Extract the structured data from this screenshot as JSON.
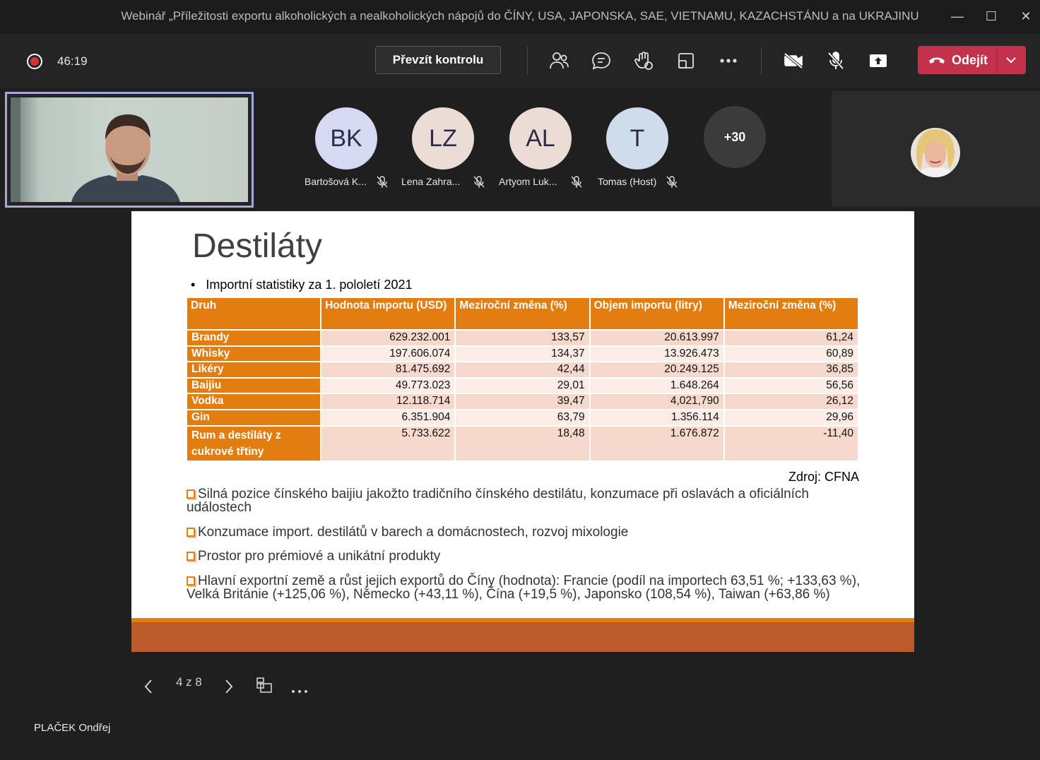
{
  "window": {
    "title": "Webinář „Příležitosti exportu alkoholických a nealkoholických nápojů do ČÍNY, USA, JAPONSKA, SAE, VIETNAMU, KAZACHSTÁNU a na UKRAJINU"
  },
  "toolbar": {
    "timer": "46:19",
    "take_control_label": "Převzít kontrolu",
    "leave_label": "Odejít",
    "icons": [
      "participants-icon",
      "chat-icon",
      "raise-hand-icon",
      "room-icon",
      "more-icon",
      "camera-off-icon",
      "mic-off-icon",
      "share-icon"
    ]
  },
  "participants": [
    {
      "initials": "BK",
      "name": "Bartošová K...",
      "color": "#d6d9f2"
    },
    {
      "initials": "LZ",
      "name": "Lena Zahra...",
      "color": "#ecdcd6"
    },
    {
      "initials": "AL",
      "name": "Artyom Luk...",
      "color": "#ecdcd6"
    },
    {
      "initials": "T",
      "name": "Tomas (Host)",
      "color": "#cfdcec"
    },
    {
      "initials": "+30",
      "name": "",
      "color": "#3b3b3b"
    }
  ],
  "slide": {
    "title": "Destiláty",
    "subtitle": "Importní statistiky za 1. pololetí 2021",
    "table": {
      "headers": [
        "Druh",
        "Hodnota importu (USD)",
        "Meziroční změna (%)",
        "Objem importu (litry)",
        "Meziroční změna (%)"
      ],
      "rows": [
        [
          "Brandy",
          "629.232.001",
          "133,57",
          "20.613.997",
          "61,24"
        ],
        [
          "Whisky",
          "197.606.074",
          "134,37",
          "13.926.473",
          "60,89"
        ],
        [
          "Likéry",
          "81.475.692",
          "42,44",
          "20.249.125",
          "36,85"
        ],
        [
          "Baijiu",
          "49.773.023",
          "29,01",
          "1.648.264",
          "56,56"
        ],
        [
          "Vodka",
          "12.118.714",
          "39,47",
          "4,021,790",
          "26,12"
        ],
        [
          "Gin",
          "6.351.904",
          "63,79",
          "1.356.114",
          "29,96"
        ],
        [
          "Rum a destiláty z cukrové třtiny",
          "5.733.622",
          "18,48",
          "1.676.872",
          "-11,40"
        ]
      ]
    },
    "source": "Zdroj: CFNA",
    "bullets": [
      "Silná pozice čínského baijiu jakožto tradičního čínského destilátu, konzumace při oslavách a oficiálních událostech",
      "Konzumace import. destilátů v barech a domácnostech, rozvoj mixologie",
      "Prostor pro prémiové a unikátní produkty",
      "Hlavní exportní země a růst jejich exportů do Číny (hodnota): Francie (podíl na importech 63,51 %; +133,63 %), Velká Británie (+125,06 %), Německo (+43,11 %), Čína (+19,5 %), Japonsko (108,54 %), Taiwan (+63,86 %)"
    ]
  },
  "nav": {
    "page_indicator": "4 z 8"
  },
  "presenter": {
    "name": "PLAČEK Ondřej"
  }
}
